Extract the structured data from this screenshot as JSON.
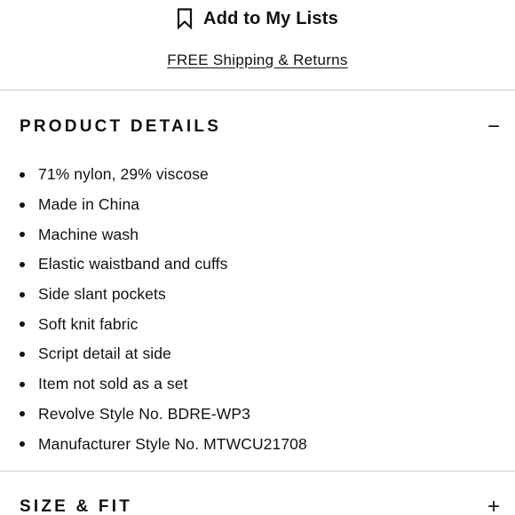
{
  "actions": {
    "add_to_lists_label": "Add to My Lists",
    "shipping_link": "FREE Shipping & Returns"
  },
  "product_details": {
    "title": "PRODUCT DETAILS",
    "toggle": "−",
    "items": [
      "71% nylon, 29% viscose",
      "Made in China",
      "Machine wash",
      "Elastic waistband and cuffs",
      "Side slant pockets",
      "Soft knit fabric",
      "Script detail at side",
      "Item not sold as a set",
      "Revolve Style No. BDRE-WP3",
      "Manufacturer Style No. MTWCU21708"
    ]
  },
  "size_fit": {
    "title": "SIZE & FIT",
    "toggle": "+"
  },
  "icons": {
    "bookmark": "bookmark-icon"
  }
}
